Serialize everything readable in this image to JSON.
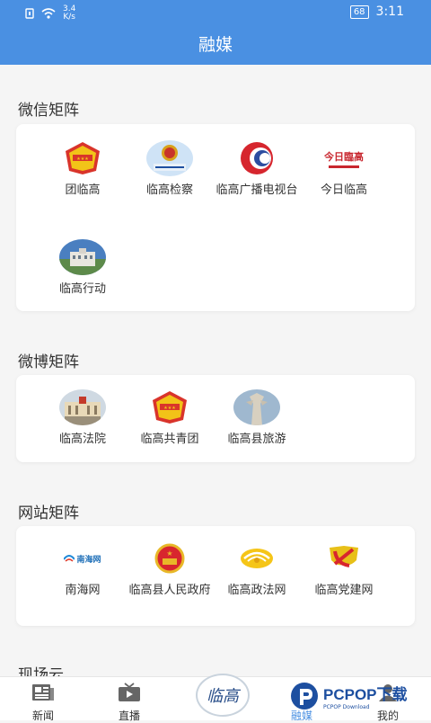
{
  "status": {
    "speed_top": "3.4",
    "speed_bottom": "K/s",
    "battery": "68",
    "time": "3:11"
  },
  "header": {
    "title": "融媒"
  },
  "sections": [
    {
      "title": "微信矩阵",
      "items": [
        {
          "label": "团临高",
          "icon": "youth-league-emblem-icon"
        },
        {
          "label": "临高检察",
          "icon": "procuratorate-emblem-icon"
        },
        {
          "label": "临高广播电视台",
          "icon": "broadcast-logo-icon"
        },
        {
          "label": "今日临高",
          "icon": "today-lingao-logo-icon"
        },
        {
          "label": "临高行动",
          "icon": "building-photo-icon"
        }
      ]
    },
    {
      "title": "微博矩阵",
      "items": [
        {
          "label": "临高法院",
          "icon": "court-building-icon"
        },
        {
          "label": "临高共青团",
          "icon": "youth-league-emblem-icon"
        },
        {
          "label": "临高县旅游",
          "icon": "statue-photo-icon"
        }
      ]
    },
    {
      "title": "网站矩阵",
      "items": [
        {
          "label": "南海网",
          "icon": "nanhai-logo-icon"
        },
        {
          "label": "临高县人民政府",
          "icon": "national-emblem-icon"
        },
        {
          "label": "临高政法网",
          "icon": "politics-law-logo-icon"
        },
        {
          "label": "临高党建网",
          "icon": "party-emblem-icon"
        }
      ]
    },
    {
      "title": "现场云"
    }
  ],
  "logo_texts": {
    "jinri": "今日臨高",
    "nanhai": "南海网"
  },
  "tabs": [
    {
      "label": "新闻",
      "icon": "newspaper-icon"
    },
    {
      "label": "直播",
      "icon": "tv-play-icon"
    },
    {
      "label": "融媒",
      "icon": "media-icon"
    },
    {
      "label": "我的",
      "icon": "user-icon"
    }
  ],
  "center_button": {
    "text": "临高"
  },
  "watermark": {
    "text": "PCPOP下载",
    "sub": "PCPOP Download"
  },
  "colors": {
    "accent": "#4a90e2",
    "background": "#f5f5f5"
  }
}
